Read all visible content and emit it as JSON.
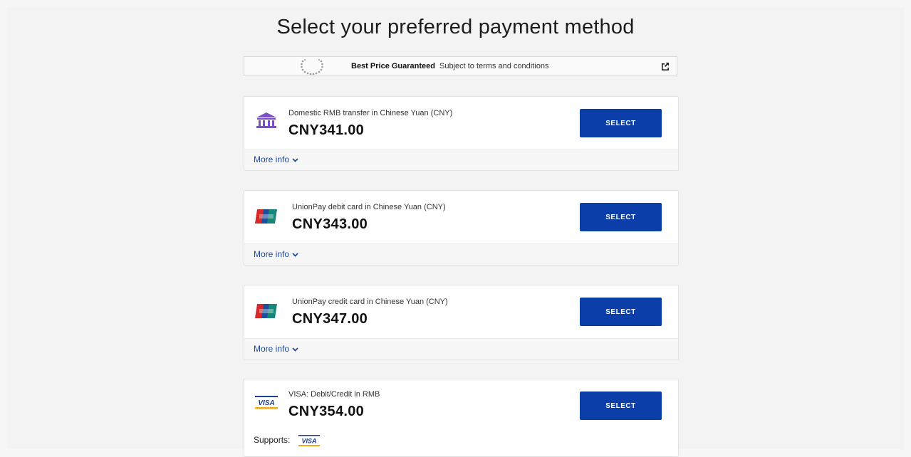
{
  "page": {
    "title": "Select your preferred payment method"
  },
  "banner": {
    "strong": "Best Price Guaranteed",
    "text": "Subject to terms and conditions"
  },
  "methods": [
    {
      "name": "Domestic RMB transfer in Chinese Yuan (CNY)",
      "price": "CNY341.00",
      "button": "SELECT",
      "more_info": "More info",
      "icon": "bank-icon"
    },
    {
      "name": "UnionPay debit card in Chinese Yuan (CNY)",
      "price": "CNY343.00",
      "button": "SELECT",
      "more_info": "More info",
      "icon": "unionpay-icon"
    },
    {
      "name": "UnionPay credit card in Chinese Yuan (CNY)",
      "price": "CNY347.00",
      "button": "SELECT",
      "more_info": "More info",
      "icon": "unionpay-icon"
    },
    {
      "name": "VISA: Debit/Credit in RMB",
      "price": "CNY354.00",
      "button": "SELECT",
      "supports_label": "Supports:",
      "icon": "visa-icon"
    }
  ],
  "colors": {
    "primary": "#0b3ea8",
    "link": "#1b4aa0",
    "bank_icon": "#7b4fc9",
    "unionpay_red": "#d62a2a",
    "unionpay_blue": "#1d4f9c",
    "visa_gold": "#f0a91a"
  }
}
